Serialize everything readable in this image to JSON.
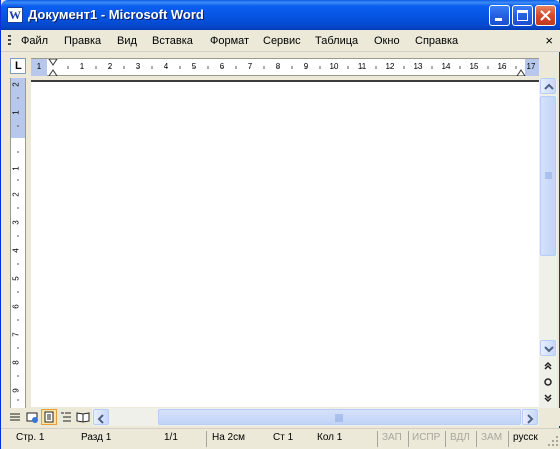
{
  "title_bar": {
    "app_icon": "word-document-icon",
    "title": "Документ1 - Microsoft Word",
    "minimize": "minimize-icon",
    "maximize": "maximize-icon",
    "close": "close-icon"
  },
  "menu": {
    "items": [
      "Файл",
      "Правка",
      "Вид",
      "Вставка",
      "Формат",
      "Сервис",
      "Таблица",
      "Окно",
      "Справка"
    ],
    "close_doc": "×"
  },
  "ruler": {
    "tab_selector": "L",
    "h_numbers": [
      "1",
      "1",
      "2",
      "3",
      "4",
      "5",
      "6",
      "7",
      "8",
      "9",
      "10",
      "11",
      "12",
      "13",
      "14",
      "15",
      "16",
      "17"
    ],
    "v_numbers": [
      "2",
      "1",
      "1",
      "2",
      "3",
      "4",
      "5",
      "6",
      "7",
      "8",
      "9"
    ]
  },
  "views": {
    "normal": "normal-view-icon",
    "web": "web-layout-icon",
    "print": "print-layout-icon",
    "outline": "outline-view-icon",
    "reading": "reading-layout-icon"
  },
  "status": {
    "page": "Стр. 1",
    "section": "Разд 1",
    "pages": "1/1",
    "at": "На 2см",
    "line": "Ст 1",
    "col": "Кол 1",
    "rec": "ЗАП",
    "trk": "ИСПР",
    "ext": "ВДЛ",
    "ovr": "ЗАМ",
    "lang": "русск"
  },
  "colors": {
    "titlebar": "#0553e0",
    "chrome": "#ece9d8",
    "ruler_margin": "#b7c8ec",
    "active_view": "#fde3a3"
  }
}
